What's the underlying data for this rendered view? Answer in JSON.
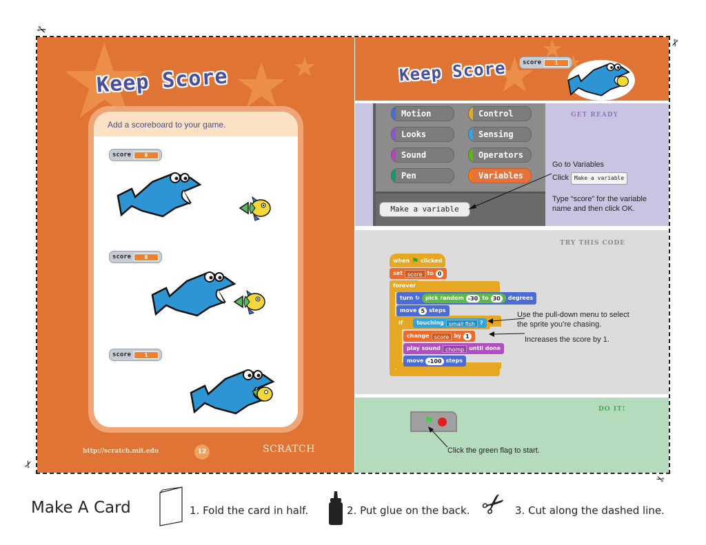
{
  "left_page": {
    "title": "Keep Score",
    "subtitle": "Add a scoreboard to your game.",
    "frames": [
      {
        "monitor_label": "score",
        "monitor_value": "0",
        "scene": "shark-approaching-fish"
      },
      {
        "monitor_label": "score",
        "monitor_value": "0",
        "scene": "shark-near-fish"
      },
      {
        "monitor_label": "score",
        "monitor_value": "1",
        "scene": "shark-eating-fish"
      }
    ],
    "footer": {
      "url": "http://scratch.mit.edu",
      "page_number": "12",
      "logo": "SCRATCH"
    }
  },
  "right_page": {
    "header": {
      "title": "Keep Score",
      "monitor_label": "score",
      "monitor_value": "1"
    },
    "get_ready": {
      "label": "GET READY",
      "categories": [
        {
          "label": "Motion",
          "color": "#4a6cd4"
        },
        {
          "label": "Control",
          "color": "#e6a822"
        },
        {
          "label": "Looks",
          "color": "#8a55d7"
        },
        {
          "label": "Sensing",
          "color": "#2ca5e2"
        },
        {
          "label": "Sound",
          "color": "#bb42c3"
        },
        {
          "label": "Operators",
          "color": "#5cb712"
        },
        {
          "label": "Pen",
          "color": "#0e9a6c"
        },
        {
          "label": "Variables",
          "color": "#ee7d16"
        }
      ],
      "active_category": "Variables",
      "make_variable_button": "Make a variable",
      "instruction_1": "Go to Variables",
      "instruction_2_prefix": "Click",
      "instruction_2_button": "Make a variable",
      "instruction_3": "Type “score” for the variable name and then click OK."
    },
    "try_code": {
      "label": "TRY THIS CODE",
      "blocks": {
        "when_prefix": "when",
        "when_suffix": "clicked",
        "set": "set",
        "set_var": "score",
        "set_to": "to",
        "set_value": "0",
        "forever": "forever",
        "turn": "turn",
        "pick_random": "pick random",
        "random_from": "-30",
        "random_to_word": "to",
        "random_to": "30",
        "degrees": "degrees",
        "move": "move",
        "move_steps": "5",
        "steps": "steps",
        "if": "if",
        "touching": "touching",
        "touching_target": "small fish",
        "question": "?",
        "change": "change",
        "change_var": "score",
        "by": "by",
        "change_value": "1",
        "play_sound": "play sound",
        "sound_name": "chomp",
        "until_done": "until done",
        "move2": "move",
        "move2_steps": "-100",
        "steps2": "steps"
      },
      "annotation_1": "Use the pull-down menu to select the sprite you’re chasing.",
      "annotation_2": "Increases the score by 1."
    },
    "do_it": {
      "label": "DO IT!",
      "instruction": "Click the green flag to start."
    }
  },
  "instructions": {
    "title": "Make A Card",
    "steps": [
      {
        "icon": "folded-card-icon",
        "text": "1. Fold the card in half."
      },
      {
        "icon": "glue-bottle-icon",
        "text": "2. Put glue on the back."
      },
      {
        "icon": "scissors-icon",
        "text": "3. Cut along the dashed line."
      }
    ]
  },
  "colors": {
    "orange": "#e07434",
    "lavender": "#c9c4e2",
    "gray": "#dcdcdc",
    "green": "#b4dcbc",
    "title_blue": "#4a4f9c"
  }
}
